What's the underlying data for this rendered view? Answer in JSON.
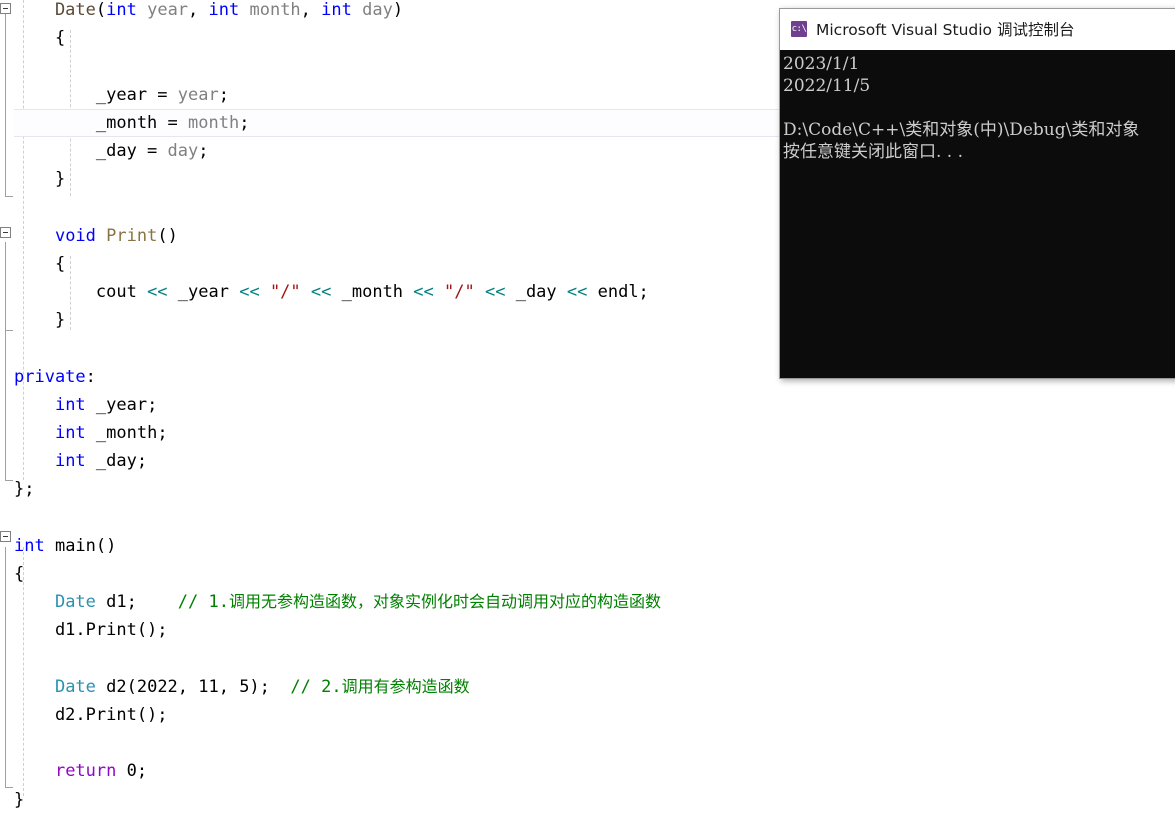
{
  "editor": {
    "language": "cpp",
    "current_line_index": 4,
    "lines": [
      {
        "indent": 0,
        "tokens": [
          {
            "t": "    Date",
            "c": "t-ctor"
          },
          {
            "t": "(",
            "c": "t-plain"
          },
          {
            "t": "int",
            "c": "t-kw"
          },
          {
            "t": " year",
            "c": "t-param"
          },
          {
            "t": ", ",
            "c": "t-plain"
          },
          {
            "t": "int",
            "c": "t-kw"
          },
          {
            "t": " month",
            "c": "t-param"
          },
          {
            "t": ", ",
            "c": "t-plain"
          },
          {
            "t": "int",
            "c": "t-kw"
          },
          {
            "t": " day",
            "c": "t-param"
          },
          {
            "t": ")",
            "c": "t-plain"
          }
        ]
      },
      {
        "indent": 0,
        "tokens": [
          {
            "t": "    {",
            "c": "t-plain"
          }
        ]
      },
      {
        "indent": 0,
        "tokens": [
          {
            "t": "",
            "c": "t-plain"
          }
        ]
      },
      {
        "indent": 0,
        "tokens": [
          {
            "t": "        _year = ",
            "c": "t-plain"
          },
          {
            "t": "year",
            "c": "t-param"
          },
          {
            "t": ";",
            "c": "t-plain"
          }
        ]
      },
      {
        "indent": 0,
        "tokens": [
          {
            "t": "        _month = ",
            "c": "t-plain"
          },
          {
            "t": "month",
            "c": "t-param"
          },
          {
            "t": ";",
            "c": "t-plain"
          }
        ]
      },
      {
        "indent": 0,
        "tokens": [
          {
            "t": "        _day = ",
            "c": "t-plain"
          },
          {
            "t": "day",
            "c": "t-param"
          },
          {
            "t": ";",
            "c": "t-plain"
          }
        ]
      },
      {
        "indent": 0,
        "tokens": [
          {
            "t": "    }",
            "c": "t-plain"
          }
        ]
      },
      {
        "indent": 0,
        "tokens": [
          {
            "t": "",
            "c": "t-plain"
          }
        ]
      },
      {
        "indent": 0,
        "tokens": [
          {
            "t": "    ",
            "c": "t-plain"
          },
          {
            "t": "void",
            "c": "t-kw"
          },
          {
            "t": " ",
            "c": "t-plain"
          },
          {
            "t": "Print",
            "c": "t-func"
          },
          {
            "t": "()",
            "c": "t-plain"
          }
        ]
      },
      {
        "indent": 0,
        "tokens": [
          {
            "t": "    {",
            "c": "t-plain"
          }
        ]
      },
      {
        "indent": 0,
        "tokens": [
          {
            "t": "        cout ",
            "c": "t-plain"
          },
          {
            "t": "<<",
            "c": "t-op"
          },
          {
            "t": " _year ",
            "c": "t-plain"
          },
          {
            "t": "<<",
            "c": "t-op"
          },
          {
            "t": " ",
            "c": "t-plain"
          },
          {
            "t": "\"/\"",
            "c": "t-str"
          },
          {
            "t": " ",
            "c": "t-plain"
          },
          {
            "t": "<<",
            "c": "t-op"
          },
          {
            "t": " _month ",
            "c": "t-plain"
          },
          {
            "t": "<<",
            "c": "t-op"
          },
          {
            "t": " ",
            "c": "t-plain"
          },
          {
            "t": "\"/\"",
            "c": "t-str"
          },
          {
            "t": " ",
            "c": "t-plain"
          },
          {
            "t": "<<",
            "c": "t-op"
          },
          {
            "t": " _day ",
            "c": "t-plain"
          },
          {
            "t": "<<",
            "c": "t-op"
          },
          {
            "t": " endl;",
            "c": "t-plain"
          }
        ]
      },
      {
        "indent": 0,
        "tokens": [
          {
            "t": "    }",
            "c": "t-plain"
          }
        ]
      },
      {
        "indent": 0,
        "tokens": [
          {
            "t": "",
            "c": "t-plain"
          }
        ]
      },
      {
        "indent": 0,
        "tokens": [
          {
            "t": "private",
            "c": "t-kw"
          },
          {
            "t": ":",
            "c": "t-plain"
          }
        ]
      },
      {
        "indent": 0,
        "tokens": [
          {
            "t": "    ",
            "c": "t-plain"
          },
          {
            "t": "int",
            "c": "t-kw"
          },
          {
            "t": " _year;",
            "c": "t-plain"
          }
        ]
      },
      {
        "indent": 0,
        "tokens": [
          {
            "t": "    ",
            "c": "t-plain"
          },
          {
            "t": "int",
            "c": "t-kw"
          },
          {
            "t": " _month;",
            "c": "t-plain"
          }
        ]
      },
      {
        "indent": 0,
        "tokens": [
          {
            "t": "    ",
            "c": "t-plain"
          },
          {
            "t": "int",
            "c": "t-kw"
          },
          {
            "t": " _day;",
            "c": "t-plain"
          }
        ]
      },
      {
        "indent": 0,
        "tokens": [
          {
            "t": "};",
            "c": "t-plain"
          }
        ]
      },
      {
        "indent": 0,
        "tokens": [
          {
            "t": "",
            "c": "t-plain"
          }
        ]
      },
      {
        "indent": 0,
        "tokens": [
          {
            "t": "int",
            "c": "t-kw"
          },
          {
            "t": " main()",
            "c": "t-plain"
          }
        ]
      },
      {
        "indent": 0,
        "tokens": [
          {
            "t": "{",
            "c": "t-plain"
          }
        ]
      },
      {
        "indent": 0,
        "tokens": [
          {
            "t": "    ",
            "c": "t-plain"
          },
          {
            "t": "Date",
            "c": "t-type"
          },
          {
            "t": " d1;    ",
            "c": "t-plain"
          },
          {
            "t": "// 1.",
            "c": "t-comment"
          },
          {
            "t": "调用无参构造函数，对象实例化时会自动调用对应的构造函数",
            "c": "t-comment cn"
          }
        ]
      },
      {
        "indent": 0,
        "tokens": [
          {
            "t": "    d1.Print();",
            "c": "t-plain"
          }
        ]
      },
      {
        "indent": 0,
        "tokens": [
          {
            "t": "",
            "c": "t-plain"
          }
        ]
      },
      {
        "indent": 0,
        "tokens": [
          {
            "t": "    ",
            "c": "t-plain"
          },
          {
            "t": "Date",
            "c": "t-type"
          },
          {
            "t": " d2(2022, 11, 5);  ",
            "c": "t-plain"
          },
          {
            "t": "// 2.",
            "c": "t-comment"
          },
          {
            "t": "调用有参构造函数",
            "c": "t-comment cn"
          }
        ]
      },
      {
        "indent": 0,
        "tokens": [
          {
            "t": "    d2.Print();",
            "c": "t-plain"
          }
        ]
      },
      {
        "indent": 0,
        "tokens": [
          {
            "t": "",
            "c": "t-plain"
          }
        ]
      },
      {
        "indent": 0,
        "tokens": [
          {
            "t": "    ",
            "c": "t-plain"
          },
          {
            "t": "return",
            "c": "t-ctrl"
          },
          {
            "t": " 0;",
            "c": "t-plain"
          }
        ]
      },
      {
        "indent": 0,
        "tokens": [
          {
            "t": "}",
            "c": "t-plain"
          }
        ]
      }
    ]
  },
  "console": {
    "title": "Microsoft Visual Studio 调试控制台",
    "icon": "console-icon",
    "icon_text": "c:\\",
    "output": [
      "2023/1/1",
      "2022/11/5",
      "",
      "D:\\Code\\C++\\类和对象(中)\\Debug\\类和对象",
      "按任意键关闭此窗口. . ."
    ]
  },
  "colors": {
    "editor_bg": "#ffffff",
    "keyword": "#0000ff",
    "control_keyword": "#8f08c4",
    "class_type": "#2b91af",
    "function": "#8a7342",
    "string": "#a31515",
    "operator": "#008080",
    "comment": "#008000",
    "parameter": "#808080",
    "console_bg": "#0c0c0c",
    "console_fg": "#cccccc",
    "console_titlebar": "#ffffff",
    "current_line_border": "#e4e6f1"
  }
}
